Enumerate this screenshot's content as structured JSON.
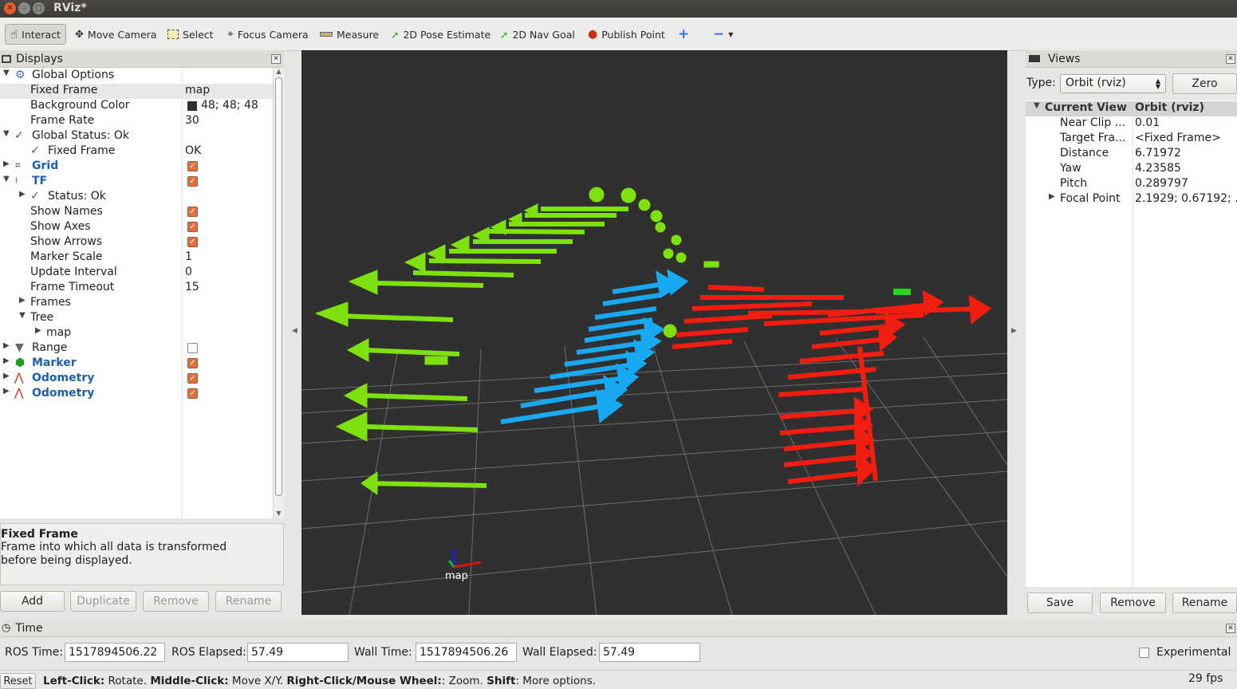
{
  "window": {
    "title": "RViz*"
  },
  "toolbar": {
    "tools": [
      {
        "label": "Interact",
        "icon": "hand-pointer-icon"
      },
      {
        "label": "Move Camera",
        "icon": "move-camera-icon"
      },
      {
        "label": "Select",
        "icon": "select-box-icon"
      },
      {
        "label": "Focus Camera",
        "icon": "focus-camera-icon"
      },
      {
        "label": "Measure",
        "icon": "ruler-icon"
      },
      {
        "label": "2D Pose Estimate",
        "icon": "green-arrow-icon"
      },
      {
        "label": "2D Nav Goal",
        "icon": "green-arrow-icon"
      },
      {
        "label": "Publish Point",
        "icon": "map-pin-icon"
      }
    ]
  },
  "displays": {
    "title": "Displays",
    "global_options": "Global Options",
    "fixed_frame_label": "Fixed Frame",
    "fixed_frame_value": "map",
    "bg_color_label": "Background Color",
    "bg_color_value": "48; 48; 48",
    "frame_rate_label": "Frame Rate",
    "frame_rate_value": "30",
    "global_status": "Global Status: Ok",
    "gs_fixed_frame": "Fixed Frame",
    "gs_fixed_frame_value": "OK",
    "grid": "Grid",
    "tf": "TF",
    "tf_status": "Status: Ok",
    "show_names": "Show Names",
    "show_axes": "Show Axes",
    "show_arrows": "Show Arrows",
    "marker_scale": "Marker Scale",
    "marker_scale_value": "1",
    "update_interval": "Update Interval",
    "update_interval_value": "0",
    "frame_timeout": "Frame Timeout",
    "frame_timeout_value": "15",
    "frames": "Frames",
    "tree": "Tree",
    "tree_map": "map",
    "range": "Range",
    "marker": "Marker",
    "odometry1": "Odometry",
    "odometry2": "Odometry"
  },
  "description": {
    "title": "Fixed Frame",
    "text": "Frame into which all data is transformed before being displayed."
  },
  "display_buttons": {
    "add": "Add",
    "duplicate": "Duplicate",
    "remove": "Remove",
    "rename": "Rename"
  },
  "viewport": {
    "axis_label": "map"
  },
  "views": {
    "title": "Views",
    "type_label": "Type:",
    "type_value": "Orbit (rviz)",
    "zero": "Zero",
    "current_view": "Current View",
    "current_view_value": "Orbit (rviz)",
    "props": [
      {
        "name": "Near Clip ...",
        "value": "0.01"
      },
      {
        "name": "Target Fra...",
        "value": "<Fixed Frame>"
      },
      {
        "name": "Distance",
        "value": "6.71972"
      },
      {
        "name": "Yaw",
        "value": "4.23585"
      },
      {
        "name": "Pitch",
        "value": "0.289797"
      },
      {
        "name": "Focal Point",
        "value": "2.1929; 0.67192; ..."
      }
    ],
    "save": "Save",
    "remove": "Remove",
    "rename": "Rename"
  },
  "time": {
    "title": "Time",
    "ros_time_label": "ROS Time:",
    "ros_time": "1517894506.22",
    "ros_elapsed_label": "ROS Elapsed:",
    "ros_elapsed": "57.49",
    "wall_time_label": "Wall Time:",
    "wall_time": "1517894506.26",
    "wall_elapsed_label": "Wall Elapsed:",
    "wall_elapsed": "57.49",
    "experimental": "Experimental"
  },
  "statusbar": {
    "reset": "Reset",
    "k1": "Left-Click:",
    "v1": " Rotate. ",
    "k2": "Middle-Click:",
    "v2": " Move X/Y. ",
    "k3": "Right-Click/Mouse Wheel:",
    "v3": ": Zoom. ",
    "k4": "Shift",
    "v4": ": More options.",
    "fps": "29 fps"
  }
}
